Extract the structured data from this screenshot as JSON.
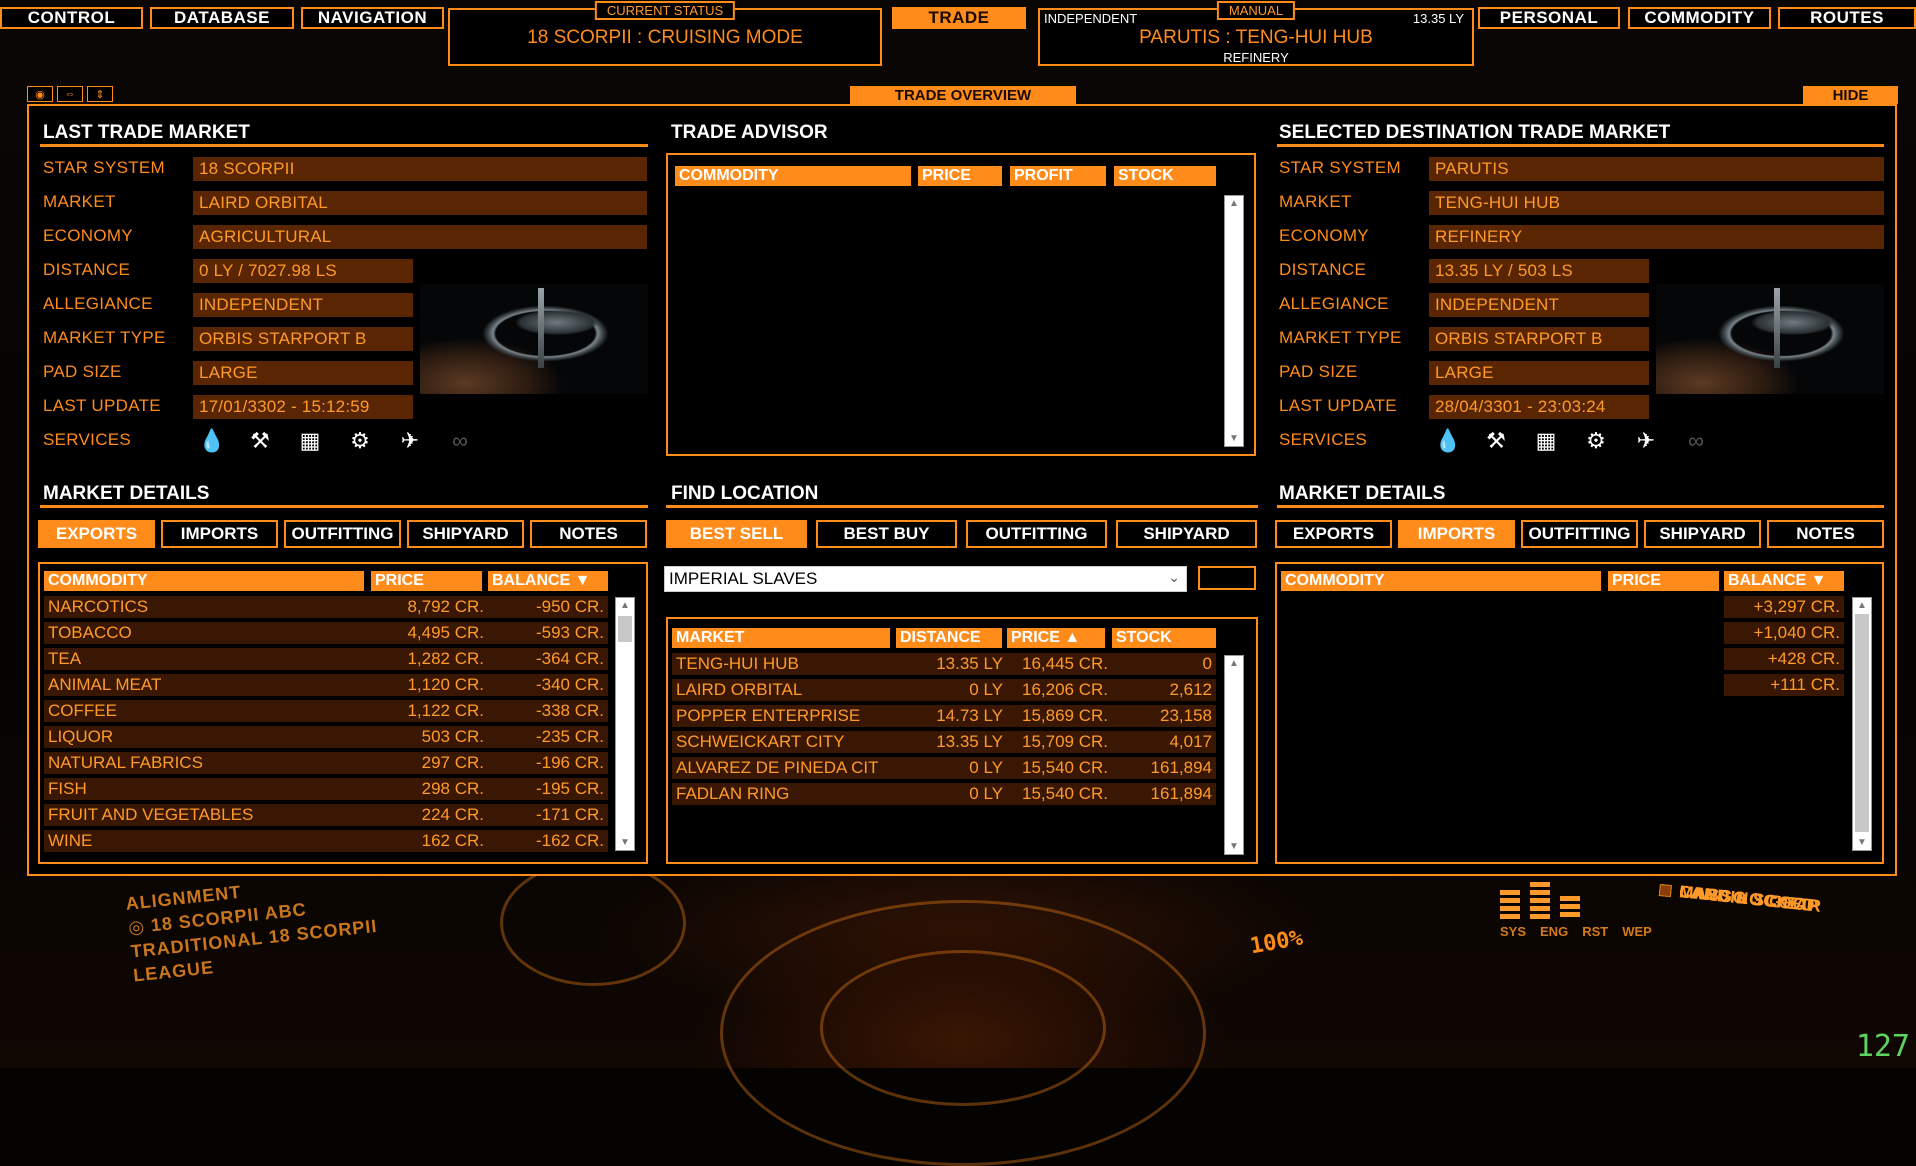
{
  "nav": {
    "control": "CONTROL",
    "database": "DATABASE",
    "navigation": "NAVIGATION",
    "trade": "TRADE",
    "personal": "PERSONAL",
    "commodity": "COMMODITY",
    "routes": "ROUTES"
  },
  "current_status": {
    "tag": "CURRENT STATUS",
    "text": "18 SCORPII : CRUISING MODE"
  },
  "manual_status": {
    "tag": "MANUAL",
    "allegiance": "INDEPENDENT",
    "distance": "13.35 LY",
    "location": "PARUTIS : TENG-HUI HUB",
    "economy": "REFINERY"
  },
  "panel": {
    "overview_tab": "TRADE OVERVIEW",
    "hide": "HIDE"
  },
  "last_market": {
    "title": "LAST TRADE MARKET",
    "labels": [
      "STAR SYSTEM",
      "MARKET",
      "ECONOMY",
      "DISTANCE",
      "ALLEGIANCE",
      "MARKET TYPE",
      "PAD SIZE",
      "LAST UPDATE",
      "SERVICES"
    ],
    "values": [
      "18 SCORPII",
      "LAIRD ORBITAL",
      "AGRICULTURAL",
      "0 LY / 7027.98 LS",
      "INDEPENDENT",
      "ORBIS STARPORT B",
      "LARGE",
      "17/01/3302 - 15:12:59"
    ]
  },
  "dest_market": {
    "title": "SELECTED DESTINATION TRADE MARKET",
    "labels": [
      "STAR SYSTEM",
      "MARKET",
      "ECONOMY",
      "DISTANCE",
      "ALLEGIANCE",
      "MARKET TYPE",
      "PAD SIZE",
      "LAST UPDATE",
      "SERVICES"
    ],
    "values": [
      "PARUTIS",
      "TENG-HUI HUB",
      "REFINERY",
      "13.35 LY / 503 LS",
      "INDEPENDENT",
      "ORBIS STARPORT B",
      "LARGE",
      "28/04/3301 - 23:03:24"
    ]
  },
  "service_icons": [
    "refuel-icon",
    "repair-icon",
    "market-icon",
    "outfitting-icon",
    "shipyard-icon",
    "black-market-icon"
  ],
  "trade_advisor": {
    "title": "TRADE ADVISOR",
    "headers": [
      "COMMODITY",
      "PRICE",
      "PROFIT",
      "STOCK"
    ]
  },
  "market_details_left": {
    "title": "MARKET DETAILS",
    "tabs": [
      "EXPORTS",
      "IMPORTS",
      "OUTFITTING",
      "SHIPYARD",
      "NOTES"
    ],
    "active_tab": "EXPORTS",
    "headers": [
      "COMMODITY",
      "PRICE",
      "BALANCE ▼"
    ],
    "rows": [
      [
        "NARCOTICS",
        "8,792 CR.",
        "-950 CR."
      ],
      [
        "TOBACCO",
        "4,495 CR.",
        "-593 CR."
      ],
      [
        "TEA",
        "1,282 CR.",
        "-364 CR."
      ],
      [
        "ANIMAL MEAT",
        "1,120 CR.",
        "-340 CR."
      ],
      [
        "COFFEE",
        "1,122 CR.",
        "-338 CR."
      ],
      [
        "LIQUOR",
        "503 CR.",
        "-235 CR."
      ],
      [
        "NATURAL FABRICS",
        "297 CR.",
        "-196 CR."
      ],
      [
        "FISH",
        "298 CR.",
        "-195 CR."
      ],
      [
        "FRUIT AND VEGETABLES",
        "224 CR.",
        "-171 CR."
      ],
      [
        "WINE",
        "162 CR.",
        "-162 CR."
      ]
    ]
  },
  "find_location": {
    "title": "FIND LOCATION",
    "tabs": [
      "BEST SELL",
      "BEST BUY",
      "OUTFITTING",
      "SHIPYARD"
    ],
    "active_tab": "BEST SELL",
    "dropdown": "IMPERIAL SLAVES",
    "headers": [
      "MARKET",
      "DISTANCE",
      "PRICE ▲",
      "STOCK"
    ],
    "rows": [
      [
        "TENG-HUI HUB",
        "13.35 LY",
        "16,445 CR.",
        "0"
      ],
      [
        "LAIRD ORBITAL",
        "0 LY",
        "16,206 CR.",
        "2,612"
      ],
      [
        "POPPER ENTERPRISE",
        "14.73 LY",
        "15,869 CR.",
        "23,158"
      ],
      [
        "SCHWEICKART CITY",
        "13.35 LY",
        "15,709 CR.",
        "4,017"
      ],
      [
        "ALVAREZ DE PINEDA CIT",
        "0 LY",
        "15,540 CR.",
        "161,894"
      ],
      [
        "FADLAN RING",
        "0 LY",
        "15,540 CR.",
        "161,894"
      ]
    ]
  },
  "market_details_right": {
    "title": "MARKET DETAILS",
    "tabs": [
      "EXPORTS",
      "IMPORTS",
      "OUTFITTING",
      "SHIPYARD",
      "NOTES"
    ],
    "active_tab": "IMPORTS",
    "headers": [
      "COMMODITY",
      "PRICE",
      "BALANCE ▼"
    ],
    "balances": [
      "+3,297 CR.",
      "+1,040 CR.",
      "+428 CR.",
      "+111 CR."
    ]
  },
  "cockpit": {
    "alignment": "ALIGNMENT",
    "target": "18 SCORPII ABC",
    "faction_line1": "TRADITIONAL 18 SCORPII",
    "faction_line2": "LEAGUE",
    "throttle": "100%",
    "pip_labels": [
      "SYS",
      "ENG",
      "RST",
      "WEP"
    ],
    "indicators": [
      "MASS LOCKED",
      "LANDING GEAR",
      "CARGO SCOOP"
    ],
    "fps": "127"
  },
  "colors": {
    "accent": "#ff8c1a",
    "field_bg": "#5a2503",
    "row_bg": "#3a1702"
  }
}
